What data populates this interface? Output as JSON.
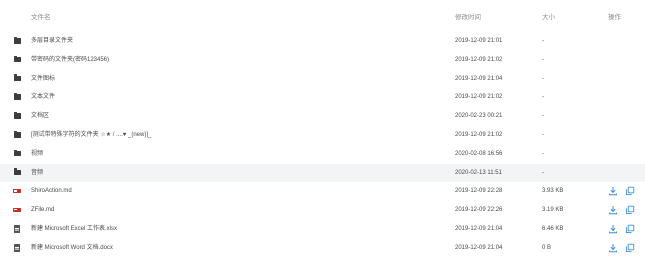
{
  "header": {
    "name": "文件名",
    "modified": "修改时间",
    "size": "大小",
    "actions": "操作"
  },
  "colors": {
    "link_blue": "#3b8fe0"
  },
  "rows": [
    {
      "name": "多层目录文件夹",
      "time": "2019-12-09 21:01",
      "size": "-",
      "type": "folder"
    },
    {
      "name": "带密码的文件夹(密码123456)",
      "time": "2019-12-09 21:02",
      "size": "-",
      "type": "folder"
    },
    {
      "name": "文件图标",
      "time": "2019-12-09 21:04",
      "size": "-",
      "type": "folder"
    },
    {
      "name": "文本文件",
      "time": "2019-12-09 21:02",
      "size": "-",
      "type": "folder"
    },
    {
      "name": "文档区",
      "time": "2020-02-23 00:21",
      "size": "-",
      "type": "folder"
    },
    {
      "name": "[测试带特殊字符的文件夹 ☆★ / ....♥ _(new)]_",
      "time": "2019-12-09 21:02",
      "size": "-",
      "type": "folder"
    },
    {
      "name": "视频",
      "time": "2020-02-08 16:56",
      "size": "-",
      "type": "folder"
    },
    {
      "name": "音频",
      "time": "2020-02-13 11:51",
      "size": "-",
      "type": "folder"
    },
    {
      "name": "ShiroAction.md",
      "time": "2019-12-09 22:28",
      "size": "3.93 KB",
      "type": "md"
    },
    {
      "name": "ZFile.md",
      "time": "2019-12-09 22:26",
      "size": "3.19 KB",
      "type": "md"
    },
    {
      "name": "新建 Microsoft Excel 工作表.xlsx",
      "time": "2019-12-09 21:04",
      "size": "6.46 KB",
      "type": "doc"
    },
    {
      "name": "新建 Microsoft Word 文档.docx",
      "time": "2019-12-09 21:04",
      "size": "0 B",
      "type": "doc"
    }
  ]
}
